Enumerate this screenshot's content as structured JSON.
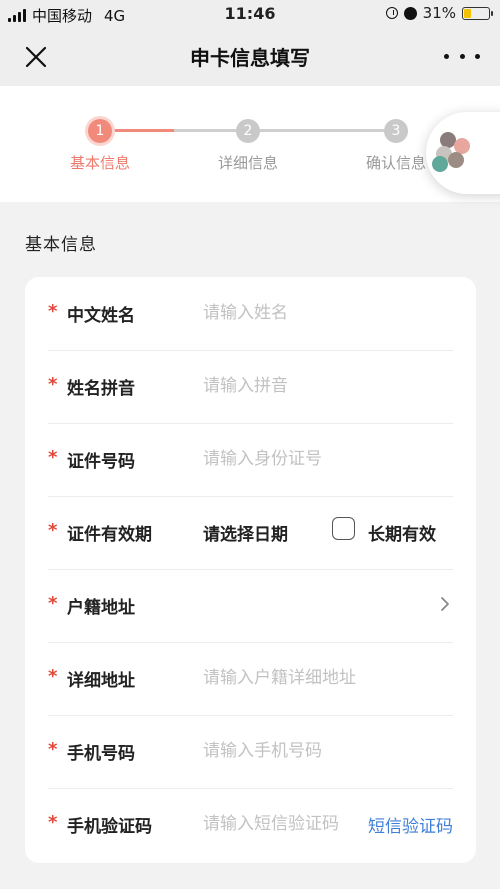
{
  "status_bar": {
    "carrier": "中国移动",
    "network": "4G",
    "time": "11:46",
    "battery": "31%",
    "battery_level": 0.31,
    "battery_color": "#f2c200"
  },
  "nav": {
    "title": "申卡信息填写",
    "close_icon": "close-icon",
    "more_icon": "more-icon"
  },
  "steps": [
    {
      "number": "1",
      "label": "基本信息",
      "active": true
    },
    {
      "number": "2",
      "label": "详细信息",
      "active": false
    },
    {
      "number": "3",
      "label": "确认信息",
      "active": false
    }
  ],
  "accent_color": "#f28a7c",
  "section_title": "基本信息",
  "form": {
    "required_mark": "*",
    "name": {
      "label": "中文姓名",
      "placeholder": "请输入姓名",
      "value": ""
    },
    "pinyin": {
      "label": "姓名拼音",
      "placeholder": "请输入拼音",
      "value": ""
    },
    "id_number": {
      "label": "证件号码",
      "placeholder": "请输入身份证号",
      "value": ""
    },
    "id_validity": {
      "label": "证件有效期",
      "select_text": "请选择日期",
      "checkbox_label": "长期有效",
      "checked": false
    },
    "address": {
      "label": "户籍地址",
      "chevron_icon": "chevron-right-icon"
    },
    "detail_address": {
      "label": "详细地址",
      "placeholder": "请输入户籍详细地址",
      "value": ""
    },
    "phone": {
      "label": "手机号码",
      "placeholder": "请输入手机号码",
      "value": ""
    },
    "sms_code": {
      "label": "手机验证码",
      "placeholder": "请输入短信验证码",
      "value": "",
      "link": "短信验证码",
      "link_color": "#3f7fd8"
    }
  }
}
